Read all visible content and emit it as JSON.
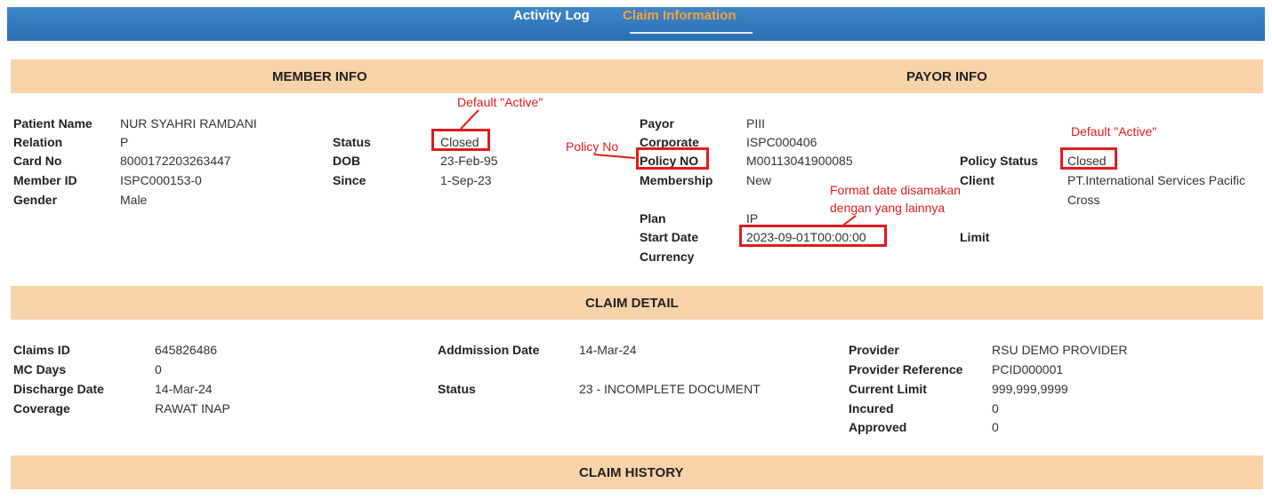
{
  "nav": {
    "tabs": [
      {
        "label": "Activity Log"
      },
      {
        "label": "Claim Information"
      }
    ]
  },
  "member_info": {
    "header": "MEMBER INFO",
    "fields": {
      "patient_name": {
        "label": "Patient Name",
        "value": "NUR SYAHRI RAMDANI"
      },
      "relation": {
        "label": "Relation",
        "value": "P"
      },
      "card_no": {
        "label": "Card No",
        "value": "8000172203263447"
      },
      "member_id": {
        "label": "Member ID",
        "value": "ISPC000153-0"
      },
      "gender": {
        "label": "Gender",
        "value": "Male"
      },
      "status": {
        "label": "Status",
        "value": "Closed"
      },
      "dob": {
        "label": "DOB",
        "value": "23-Feb-95"
      },
      "since": {
        "label": "Since",
        "value": "1-Sep-23"
      }
    }
  },
  "payor_info": {
    "header": "PAYOR INFO",
    "fields": {
      "payor": {
        "label": "Payor",
        "value": "PIII"
      },
      "corporate": {
        "label": "Corporate",
        "value": "ISPC000406"
      },
      "policy_no": {
        "label": "Policy NO",
        "value": "M00113041900085"
      },
      "membership": {
        "label": "Membership",
        "value": "New"
      },
      "plan": {
        "label": "Plan",
        "value": "IP"
      },
      "start_date": {
        "label": "Start Date",
        "value": "2023-09-01T00:00:00"
      },
      "currency": {
        "label": "Currency",
        "value": ""
      },
      "policy_status": {
        "label": "Policy Status",
        "value": "Closed"
      },
      "client": {
        "label": "Client",
        "value_line1": "PT.International Services Pacific",
        "value_line2": "Cross"
      },
      "limit": {
        "label": "Limit",
        "value": ""
      }
    }
  },
  "claim_detail": {
    "header": "CLAIM DETAIL",
    "fields": {
      "claims_id": {
        "label": "Claims ID",
        "value": "645826486"
      },
      "mc_days": {
        "label": "MC Days",
        "value": "0"
      },
      "discharge_date": {
        "label": "Discharge Date",
        "value": "14-Mar-24"
      },
      "coverage": {
        "label": "Coverage",
        "value": "RAWAT INAP"
      },
      "admission_date": {
        "label": "Addmission Date",
        "value": "14-Mar-24"
      },
      "status": {
        "label": "Status",
        "value": "23 - INCOMPLETE DOCUMENT"
      },
      "provider": {
        "label": "Provider",
        "value": "RSU DEMO PROVIDER"
      },
      "provider_reference": {
        "label": "Provider Reference",
        "value": "PCID000001"
      },
      "current_limit": {
        "label": "Current Limit",
        "value": "999,999,9999"
      },
      "incured": {
        "label": "Incured",
        "value": "0"
      },
      "approved": {
        "label": "Approved",
        "value": "0"
      }
    }
  },
  "claim_history": {
    "header": "CLAIM HISTORY"
  },
  "annotations": {
    "default_active_status": "Default \"Active\"",
    "policy_no": "Policy No",
    "default_active_policy_status": "Default \"Active\"",
    "format_date_line1": "Format date disamakan",
    "format_date_line2": "dengan yang lainnya"
  },
  "colors": {
    "nav_bar": "#2f76b9",
    "active_tab": "#f5a33a",
    "section_bar": "#f9d3a8",
    "annotation_red": "#e01c1c"
  }
}
